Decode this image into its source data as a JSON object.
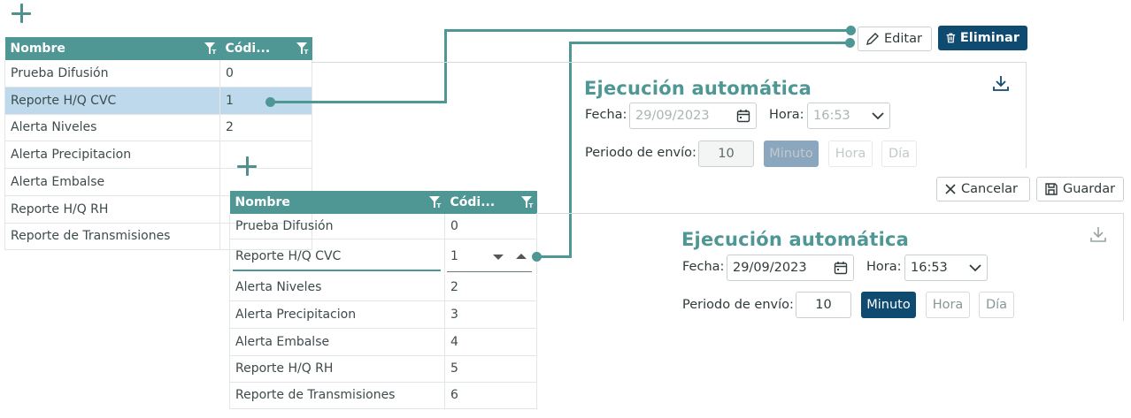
{
  "grid_headers": {
    "name": "Nombre",
    "code": "Códi..."
  },
  "grid1_rows": [
    {
      "name": "Prueba Difusión",
      "code": "0"
    },
    {
      "name": "Reporte H/Q CVC",
      "code": "1"
    },
    {
      "name": "Alerta Niveles",
      "code": "2"
    },
    {
      "name": "Alerta Precipitacion",
      "code": ""
    },
    {
      "name": "Alerta Embalse",
      "code": ""
    },
    {
      "name": "Reporte H/Q RH",
      "code": ""
    },
    {
      "name": "Reporte de Transmisiones",
      "code": ""
    }
  ],
  "grid2_rows": [
    {
      "name": "Prueba Difusión",
      "code": "0"
    },
    {
      "name": "Reporte H/Q CVC",
      "code": "1"
    },
    {
      "name": "Alerta Niveles",
      "code": "2"
    },
    {
      "name": "Alerta Precipitacion",
      "code": "3"
    },
    {
      "name": "Alerta Embalse",
      "code": "4"
    },
    {
      "name": "Reporte H/Q RH",
      "code": "5"
    },
    {
      "name": "Reporte de Transmisiones",
      "code": "6"
    }
  ],
  "toolbar": {
    "edit": "Editar",
    "delete": "Eliminar",
    "cancel": "Cancelar",
    "save": "Guardar"
  },
  "panel_view": {
    "title": "Ejecución automática",
    "date_label": "Fecha:",
    "date_value": "29/09/2023",
    "hour_label": "Hora:",
    "hour_value": "16:53",
    "period_label": "Periodo de envío:",
    "period_value": "10",
    "units": [
      "Minuto",
      "Hora",
      "Día"
    ]
  },
  "panel_edit": {
    "title": "Ejecución automática",
    "date_label": "Fecha:",
    "date_value": "29/09/2023",
    "hour_label": "Hora:",
    "hour_value": "16:53",
    "period_label": "Periodo de envío:",
    "period_value": "10",
    "units": [
      "Minuto",
      "Hora",
      "Día"
    ]
  },
  "colors": {
    "accent": "#4f9794",
    "primary": "#0f4a70",
    "selected_row": "#bfd9ec"
  }
}
